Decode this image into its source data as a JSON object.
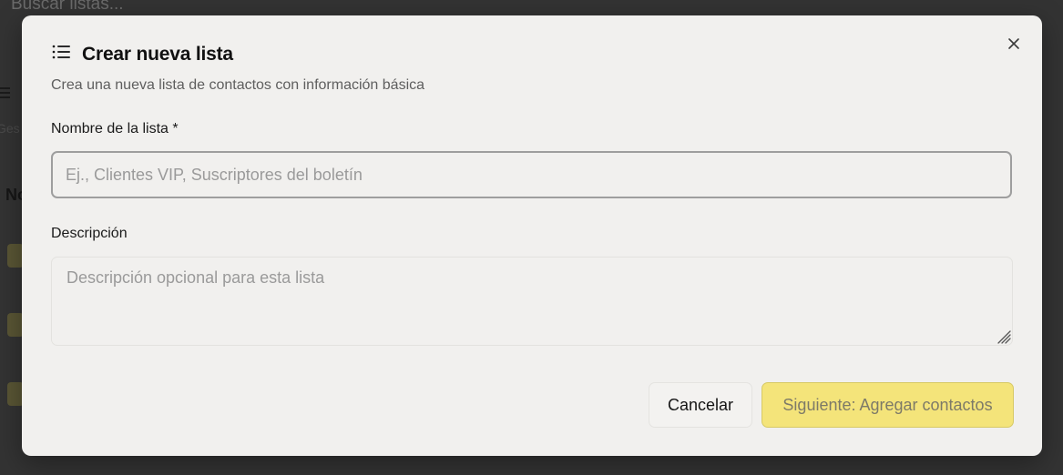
{
  "background": {
    "search_placeholder": "Buscar listas...",
    "fragment_ges": "Ges",
    "fragment_no": "No"
  },
  "modal": {
    "title": "Crear nueva lista",
    "title_icon": "list-icon",
    "subtitle": "Crea una nueva lista de contactos con información básica",
    "close_icon": "close-icon",
    "name_field": {
      "label": "Nombre de la lista *",
      "placeholder": "Ej., Clientes VIP, Suscriptores del boletín",
      "value": ""
    },
    "description_field": {
      "label": "Descripción",
      "placeholder": "Descripción opcional para esta lista",
      "value": ""
    },
    "buttons": {
      "cancel_label": "Cancelar",
      "next_label": "Siguiente: Agregar contactos"
    }
  },
  "colors": {
    "modal_bg": "#f1f0ee",
    "accent_yellow": "#f4e47a",
    "overlay": "#333333"
  }
}
